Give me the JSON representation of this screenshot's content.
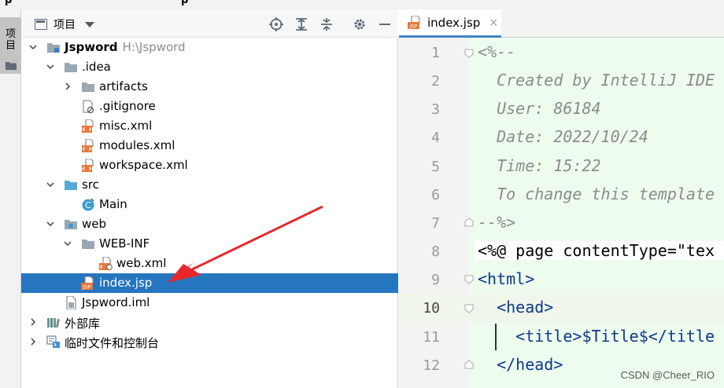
{
  "window": {
    "title_fragment_left": "p",
    "title_fragment_right": "p"
  },
  "tool_stripe": {
    "label": "项目"
  },
  "project_panel": {
    "view_label": "项目",
    "header_icons": [
      "locate-icon",
      "expand-all-icon",
      "collapse-all-icon",
      "gear-icon",
      "hide-icon"
    ]
  },
  "tree": [
    {
      "label": "Jspword",
      "path": "H:\\Jspword",
      "bold": true,
      "icon": "module-folder-icon",
      "expanded": true
    },
    {
      "label": ".idea",
      "icon": "folder-icon",
      "expanded": true
    },
    {
      "label": "artifacts",
      "icon": "folder-icon",
      "expanded": false
    },
    {
      "label": ".gitignore",
      "icon": "ignore-file-icon"
    },
    {
      "label": "misc.xml",
      "icon": "xml-file-icon"
    },
    {
      "label": "modules.xml",
      "icon": "xml-file-icon"
    },
    {
      "label": "workspace.xml",
      "icon": "xml-file-icon"
    },
    {
      "label": "src",
      "icon": "source-folder-icon",
      "expanded": true
    },
    {
      "label": "Main",
      "icon": "class-icon"
    },
    {
      "label": "web",
      "icon": "web-folder-icon",
      "expanded": true
    },
    {
      "label": "WEB-INF",
      "icon": "folder-icon",
      "expanded": true
    },
    {
      "label": "web.xml",
      "icon": "web-xml-icon"
    },
    {
      "label": "index.jsp",
      "icon": "jsp-file-icon",
      "selected": true
    },
    {
      "label": "Jspword.iml",
      "icon": "iml-file-icon"
    },
    {
      "label": "外部库",
      "icon": "library-icon",
      "expanded": false
    },
    {
      "label": "临时文件和控制台",
      "icon": "scratch-icon",
      "expanded": false
    }
  ],
  "editor": {
    "tab": {
      "label": "index.jsp",
      "icon": "jsp-file-icon",
      "close": "×"
    },
    "current_line": 10,
    "lines": [
      {
        "n": "1",
        "text": "<%--"
      },
      {
        "n": "2",
        "text": "  Created by IntelliJ IDE"
      },
      {
        "n": "3",
        "text": "  User: 86184"
      },
      {
        "n": "4",
        "text": "  Date: 2022/10/24"
      },
      {
        "n": "5",
        "text": "  Time: 15:22"
      },
      {
        "n": "6",
        "text": "  To change this template"
      },
      {
        "n": "7",
        "text": "--%>"
      },
      {
        "n": "8",
        "text": "<%@ page contentType=\"tex"
      },
      {
        "n": "9",
        "text": "<html>"
      },
      {
        "n": "10",
        "text": "  <head>"
      },
      {
        "n": "11",
        "text": "    <title>$Title$</title"
      },
      {
        "n": "12",
        "text": "  </head>"
      }
    ]
  },
  "annotation": {
    "type": "red-arrow",
    "points_to": "index.jsp"
  },
  "watermark": "CSDN @Cheer_RIO",
  "colors": {
    "selection": "#2675bf",
    "code_bg": "#edfced",
    "arrow": "#e8262b"
  }
}
